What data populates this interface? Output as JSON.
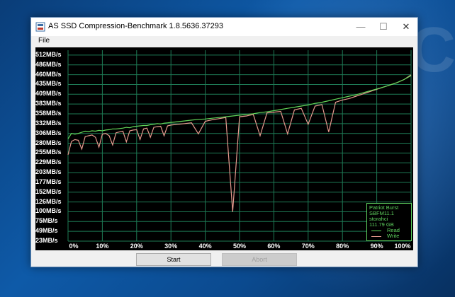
{
  "window": {
    "title": "AS SSD Compression-Benchmark 1.8.5636.37293",
    "controls": {
      "minimize": "—",
      "maximize": "☐",
      "close": "✕"
    }
  },
  "menu": {
    "file": "File"
  },
  "background": {
    "watermark_text": "TEC"
  },
  "legend": {
    "device_name": "Patriot Burst",
    "firmware": "SBFM11.1",
    "driver": "storahci",
    "capacity": "111.79 GB",
    "read_label": "Read",
    "write_label": "Write"
  },
  "buttons": {
    "start": "Start",
    "abort": "Abort"
  },
  "colors": {
    "read": "#63d85a",
    "write": "#e69a8e",
    "grid": "#1e7a55",
    "legend": "#5fd35f"
  },
  "chart_data": {
    "type": "line",
    "y_ticks": [
      "512MB/s",
      "486MB/s",
      "460MB/s",
      "435MB/s",
      "409MB/s",
      "383MB/s",
      "358MB/s",
      "332MB/s",
      "306MB/s",
      "280MB/s",
      "255MB/s",
      "229MB/s",
      "203MB/s",
      "177MB/s",
      "152MB/s",
      "126MB/s",
      "100MB/s",
      "75MB/s",
      "49MB/s",
      "23MB/s"
    ],
    "x_ticks": [
      "0%",
      "10%",
      "20%",
      "30%",
      "40%",
      "50%",
      "60%",
      "70%",
      "80%",
      "90%",
      "100%"
    ],
    "ylim": [
      23,
      512
    ],
    "xlim": [
      0,
      100
    ],
    "grid": true,
    "legend_position": "bottom-right",
    "series": [
      {
        "name": "Read",
        "x": [
          0,
          1,
          2,
          3,
          4,
          5,
          6,
          7,
          8,
          9,
          10,
          11,
          12,
          13,
          14,
          15,
          16,
          17,
          18,
          19,
          20,
          21,
          22,
          23,
          24,
          25,
          26,
          27,
          28,
          29,
          30,
          32,
          34,
          36,
          38,
          40,
          42,
          44,
          46,
          48,
          50,
          52,
          54,
          56,
          58,
          60,
          62,
          64,
          66,
          68,
          70,
          72,
          74,
          76,
          78,
          80,
          82,
          84,
          86,
          88,
          90,
          92,
          94,
          96,
          98,
          100
        ],
        "y": [
          292,
          306,
          304,
          306,
          309,
          312,
          311,
          313,
          312,
          314,
          313,
          315,
          316,
          318,
          318,
          319,
          320,
          322,
          321,
          324,
          325,
          326,
          327,
          327,
          329,
          330,
          332,
          331,
          333,
          334,
          335,
          337,
          339,
          341,
          343,
          344,
          346,
          348,
          350,
          352,
          354,
          356,
          358,
          361,
          363,
          366,
          369,
          372,
          375,
          378,
          381,
          385,
          388,
          392,
          396,
          400,
          404,
          408,
          413,
          418,
          423,
          428,
          434,
          440,
          448,
          458
        ]
      },
      {
        "name": "Write",
        "x": [
          0,
          1,
          2,
          3,
          4,
          5,
          6,
          7,
          8,
          9,
          10,
          11,
          12,
          13,
          14,
          15,
          16,
          17,
          18,
          19,
          20,
          21,
          22,
          23,
          24,
          25,
          26,
          27,
          28,
          29,
          30,
          32,
          34,
          36,
          38,
          40,
          42,
          44,
          46,
          48,
          50,
          52,
          54,
          56,
          58,
          60,
          62,
          64,
          66,
          68,
          70,
          72,
          74,
          76,
          78,
          80,
          82,
          84,
          86,
          88,
          90,
          92,
          94,
          96,
          98,
          100
        ],
        "y": [
          250,
          285,
          290,
          288,
          265,
          298,
          300,
          302,
          296,
          270,
          304,
          306,
          300,
          276,
          308,
          310,
          312,
          284,
          313,
          315,
          316,
          290,
          318,
          320,
          296,
          322,
          324,
          325,
          300,
          326,
          328,
          330,
          332,
          334,
          305,
          338,
          342,
          345,
          348,
          100,
          350,
          352,
          356,
          300,
          360,
          362,
          364,
          305,
          368,
          372,
          330,
          378,
          382,
          310,
          388,
          394,
          398,
          404,
          410,
          416,
          422,
          428,
          434,
          440,
          448,
          460
        ]
      }
    ]
  }
}
